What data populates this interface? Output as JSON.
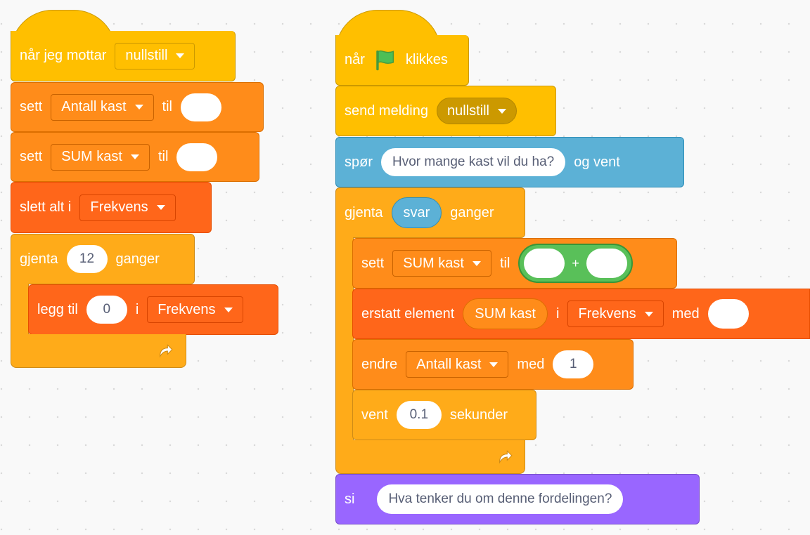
{
  "script1": {
    "hat": {
      "label": "når jeg mottar",
      "dropdown": "nullstill"
    },
    "set1": {
      "label": "sett",
      "dropdown": "Antall kast",
      "label2": "til",
      "value": ""
    },
    "set2": {
      "label": "sett",
      "dropdown": "SUM kast",
      "label2": "til",
      "value": ""
    },
    "delete_all": {
      "label": "slett alt i",
      "dropdown": "Frekvens"
    },
    "repeat": {
      "label": "gjenta",
      "value": "12",
      "label2": "ganger"
    },
    "add": {
      "label": "legg til",
      "value": "0",
      "label2": "i",
      "dropdown": "Frekvens"
    }
  },
  "script2": {
    "hat": {
      "label": "når",
      "label2": "klikkes"
    },
    "broadcast": {
      "label": "send melding",
      "dropdown": "nullstill"
    },
    "ask": {
      "label": "spør",
      "value": "Hvor mange kast vil du ha?",
      "label2": "og vent"
    },
    "repeat": {
      "label": "gjenta",
      "reporter": "svar",
      "label2": "ganger"
    },
    "set": {
      "label": "sett",
      "dropdown": "SUM kast",
      "label2": "til",
      "operator": "+"
    },
    "replace": {
      "label": "erstatt element",
      "reporter": "SUM kast",
      "label2": "i",
      "dropdown": "Frekvens",
      "label3": "med"
    },
    "change": {
      "label": "endre",
      "dropdown": "Antall kast",
      "label2": "med",
      "value": "1"
    },
    "wait": {
      "label": "vent",
      "value": "0.1",
      "label2": "sekunder"
    },
    "say": {
      "label": "si",
      "value": "Hva tenker du om denne fordelingen?"
    }
  },
  "colors": {
    "events": "#ffbf00",
    "control": "#ffab19",
    "variables": "#ff8c1a",
    "lists": "#ff661a",
    "sensing": "#5cb1d6",
    "looks": "#9966ff",
    "operators": "#59c059",
    "flag": "#4cbf56"
  },
  "icons": {
    "flag": "green-flag-icon",
    "loop": "loop-arrow-icon",
    "dropdown": "dropdown-arrow-icon"
  }
}
